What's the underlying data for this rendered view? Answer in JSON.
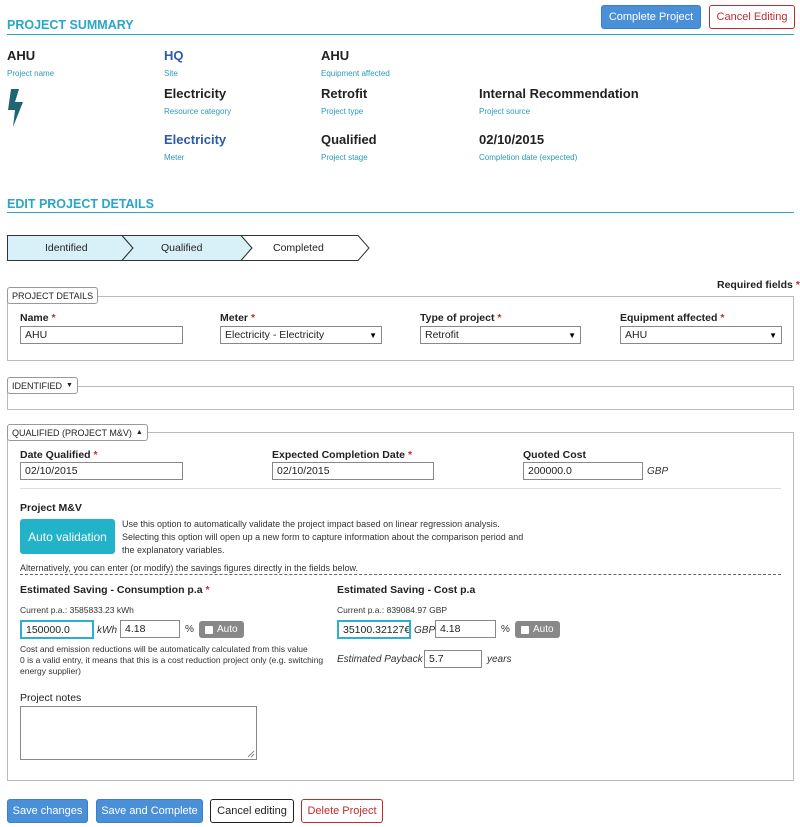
{
  "summary": {
    "title": "PROJECT SUMMARY",
    "complete_btn": "Complete Project",
    "cancel_btn": "Cancel Editing",
    "project_name": {
      "value": "AHU",
      "label": "Project name"
    },
    "site": {
      "value": "HQ",
      "label": "Site"
    },
    "equipment": {
      "value": "AHU",
      "label": "Equipment affected"
    },
    "resource": {
      "value": "Electricity",
      "label": "Resource category"
    },
    "project_type": {
      "value": "Retrofit",
      "label": "Project type"
    },
    "source": {
      "value": "Internal Recommendation",
      "label": "Project source"
    },
    "meter": {
      "value": "Electricity",
      "label": "Meter"
    },
    "stage": {
      "value": "Qualified",
      "label": "Project stage"
    },
    "completion": {
      "value": "02/10/2015",
      "label": "Completion date (expected)"
    },
    "icon": "lightning-bolt-icon"
  },
  "edit": {
    "title": "EDIT PROJECT DETAILS",
    "steps": [
      "Identified",
      "Qualified",
      "Completed"
    ],
    "required_note": "Required fields",
    "req_star": "*"
  },
  "details": {
    "tab": "PROJECT DETAILS",
    "name_label": "Name",
    "name_value": "AHU",
    "meter_label": "Meter",
    "meter_value": "Electricity - Electricity",
    "type_label": "Type of project",
    "type_value": "Retrofit",
    "equip_label": "Equipment affected",
    "equip_value": "AHU"
  },
  "identified": {
    "tab": "IDENTIFIED"
  },
  "qualified": {
    "tab": "QUALIFIED (PROJECT M&V)",
    "date_label": "Date Qualified",
    "date_value": "02/10/2015",
    "expected_label": "Expected Completion Date",
    "expected_value": "02/10/2015",
    "cost_label": "Quoted Cost",
    "cost_value": "200000.0",
    "cost_unit": "GBP",
    "mv_title": "Project M&V",
    "auto_btn": "Auto validation",
    "auto_desc": [
      "Use this option to automatically validate the project impact based on linear regression analysis.",
      "Selecting this option will open up a new form to capture information about the comparison period and",
      "the explanatory variables."
    ],
    "alt_text": "Alternatively, you can enter (or modify) the savings figures directly in the fields below.",
    "cons_label": "Estimated Saving - Consumption p.a",
    "cons_current": "Current p.a.: 3585833.23 kWh",
    "cons_value": "150000.0",
    "cons_unit": "kWh",
    "cons_pct": "4.18",
    "pct": "%",
    "auto_label": "Auto",
    "cost_save_label": "Estimated Saving - Cost p.a",
    "cost_current": "Current p.a.: 839084.97 GBP",
    "cost_save_value": "35100.32127€",
    "cost_save_unit": "GBP",
    "cost_pct": "4.18",
    "payback_label": "Estimated Payback",
    "payback_value": "5.7",
    "payback_unit": "years",
    "note": [
      "Cost and emission reductions will be automatically calculated from this value",
      "0 is a valid entry, it means that this is a cost reduction project only (e.g. switching",
      "energy supplier)"
    ],
    "notes_label": "Project notes"
  },
  "footer": {
    "save": "Save changes",
    "save_complete": "Save and Complete",
    "cancel": "Cancel editing",
    "delete": "Delete Project"
  },
  "colors": {
    "accent": "#2aa6c6",
    "blue": "#4a90d9",
    "red": "#c12c2c",
    "step_fill": "#d8f0f7"
  }
}
